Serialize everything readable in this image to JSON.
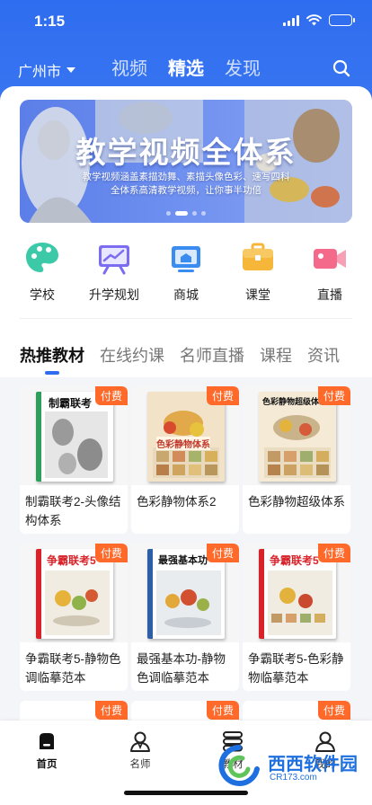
{
  "status_bar": {
    "time": "1:15"
  },
  "header": {
    "city": "广州市",
    "tabs": [
      {
        "label": "视频",
        "active": false
      },
      {
        "label": "精选",
        "active": true
      },
      {
        "label": "发现",
        "active": false
      }
    ]
  },
  "banner": {
    "title": "教学视频全体系",
    "subtitle_line1": "教学视频涵盖素描劲舞、素描头像色彩、速写四科",
    "subtitle_line2": "全体系高清教学视频，让你事半功倍",
    "page_count": 4,
    "active_page": 1
  },
  "quick_entries": [
    {
      "label": "学校",
      "icon": "palette-icon",
      "color": "#3cc9a8"
    },
    {
      "label": "升学规划",
      "icon": "chart-board-icon",
      "color": "#7b6cf0"
    },
    {
      "label": "商城",
      "icon": "shop-icon",
      "color": "#3b8cf0"
    },
    {
      "label": "课堂",
      "icon": "briefcase-icon",
      "color": "#f5b63a"
    },
    {
      "label": "直播",
      "icon": "video-camera-icon",
      "color": "#f46a8a"
    }
  ],
  "category_tabs": [
    {
      "label": "热推教材",
      "active": true
    },
    {
      "label": "在线约课",
      "active": false
    },
    {
      "label": "名师直播",
      "active": false
    },
    {
      "label": "课程",
      "active": false
    },
    {
      "label": "资讯",
      "active": false
    }
  ],
  "paid_badge": "付费",
  "books": [
    {
      "title": "制霸联考2-头像结构体系",
      "cover_title": "制霸联考",
      "cover_color": "#ffffff",
      "accent": "#2e9e5a"
    },
    {
      "title": "色彩静物体系2",
      "cover_title": "色彩静物体系",
      "cover_color": "#f2e3c8",
      "accent": "#c0392b"
    },
    {
      "title": "色彩静物超级体系",
      "cover_title": "色彩静物超级体系",
      "cover_color": "#f4ead6",
      "accent": "#c0392b"
    },
    {
      "title": "争霸联考5-静物色调临摹范本",
      "cover_title": "争霸联考5",
      "cover_color": "#ffffff",
      "accent": "#d8232a"
    },
    {
      "title": "最强基本功-静物色调临摹范本",
      "cover_title": "最强基本功",
      "cover_color": "#ffffff",
      "accent": "#2c5fa8"
    },
    {
      "title": "争霸联考5-色彩静物临摹范本",
      "cover_title": "争霸联考5",
      "cover_color": "#ffffff",
      "accent": "#d8232a"
    }
  ],
  "tabbar": [
    {
      "label": "首页",
      "icon": "home-icon",
      "active": true
    },
    {
      "label": "名师",
      "icon": "teacher-icon",
      "active": false
    },
    {
      "label": "教材",
      "icon": "books-icon",
      "active": false
    },
    {
      "label": "我的",
      "icon": "profile-icon",
      "active": false
    }
  ],
  "watermark": {
    "text": "西西软件园",
    "url": "CR173.com"
  }
}
